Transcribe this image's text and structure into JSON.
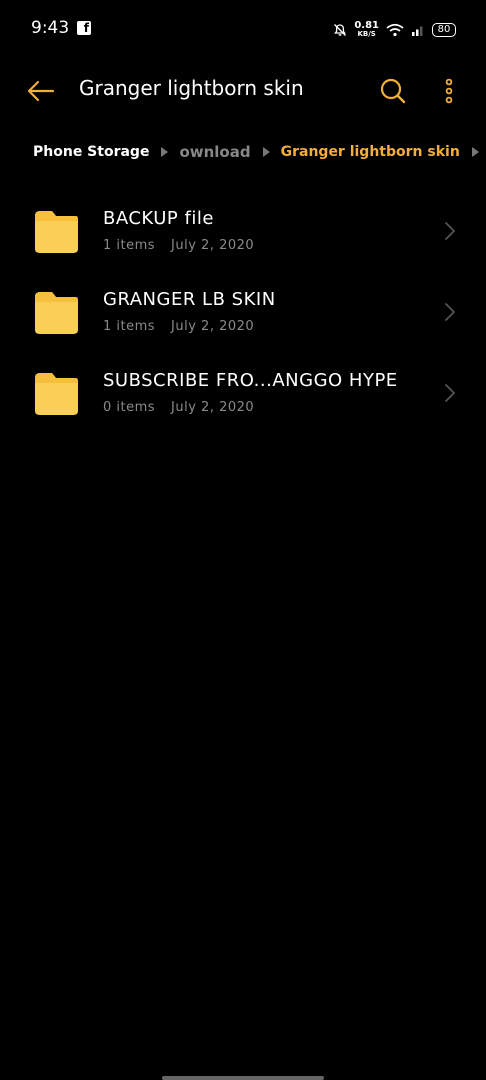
{
  "status": {
    "time": "9:43",
    "speed_value": "0.81",
    "speed_unit": "KB/S",
    "battery": "80"
  },
  "toolbar": {
    "title": "Granger lightborn skin"
  },
  "breadcrumb": {
    "items": [
      "Phone Storage",
      "ownload",
      "Granger lightborn skin"
    ]
  },
  "colors": {
    "accent": "#f2ae3b",
    "folder": "#f9cf57",
    "background": "#000000"
  },
  "folders": [
    {
      "name": "BACKUP file",
      "count": "1 items",
      "date": "July 2, 2020"
    },
    {
      "name": "GRANGER LB SKIN",
      "count": "1 items",
      "date": "July 2, 2020"
    },
    {
      "name": "SUBSCRIBE FRO...ANGGO HYPE",
      "count": "0 items",
      "date": "July 2, 2020"
    }
  ]
}
